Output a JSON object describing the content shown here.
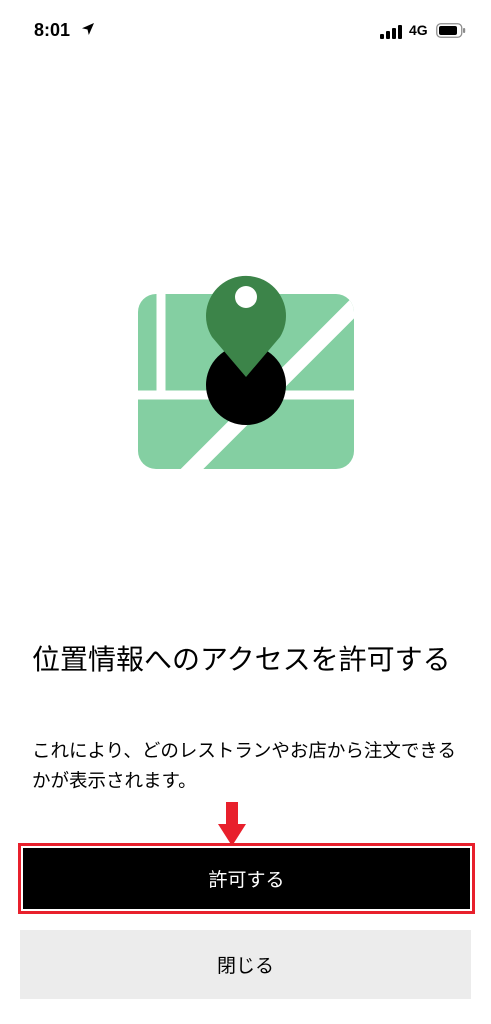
{
  "status_bar": {
    "time": "8:01",
    "network": "4G",
    "icons": [
      "location-arrow-icon",
      "signal-icon",
      "battery-icon"
    ]
  },
  "illustration": {
    "icon": "map-pin-icon",
    "colors": {
      "map": "#84cfa2",
      "pin": "#3c8449",
      "dot": "#000000"
    }
  },
  "content": {
    "title": "位置情報へのアクセスを許可する",
    "description": "これにより、どのレストランやお店から注文できるかが表示されます。"
  },
  "annotation": {
    "arrow_color": "#e8202c",
    "highlight_color": "#e8202c"
  },
  "buttons": {
    "allow_label": "許可する",
    "close_label": "閉じる"
  }
}
